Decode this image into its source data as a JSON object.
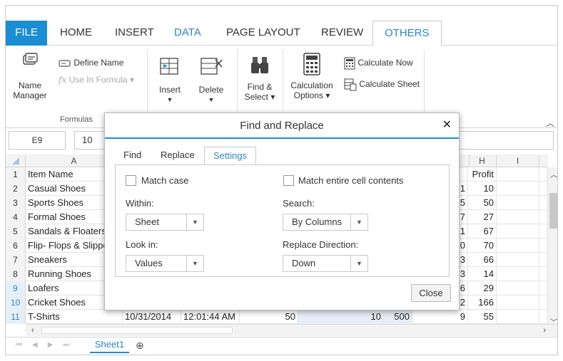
{
  "ribbon_tabs": [
    "FILE",
    "HOME",
    "INSERT",
    "DATA",
    "PAGE LAYOUT",
    "REVIEW",
    "OTHERS"
  ],
  "ribbon": {
    "name_manager": "Name Manager",
    "define_name": "Define Name",
    "use_in_formula": "Use In Formula",
    "formulas_group": "Formulas",
    "insert": "Insert",
    "delete": "Delete",
    "find_select": "Find & Select",
    "calculation_options": "Calculation Options",
    "calculate_now": "Calculate Now",
    "calculate_sheet": "Calculate Sheet"
  },
  "formula_bar": {
    "name_box": "E9",
    "formula": "10"
  },
  "columns": [
    "A",
    "H",
    "I"
  ],
  "rows": [
    {
      "n": "1",
      "a": "Item Name",
      "g": "",
      "h": "Profit"
    },
    {
      "n": "2",
      "a": "Casual Shoes",
      "g": "1",
      "h": "10"
    },
    {
      "n": "3",
      "a": "Sports Shoes",
      "g": "5",
      "h": "50"
    },
    {
      "n": "4",
      "a": "Formal Shoes",
      "g": "7",
      "h": "27"
    },
    {
      "n": "5",
      "a": "Sandals & Floaters",
      "g": "1",
      "h": "67"
    },
    {
      "n": "6",
      "a": "Flip- Flops & Slippers",
      "g": "0",
      "h": "70"
    },
    {
      "n": "7",
      "a": "Sneakers",
      "g": "3",
      "h": "66"
    },
    {
      "n": "8",
      "a": "Running Shoes",
      "g": "3",
      "h": "14"
    },
    {
      "n": "9",
      "a": "Loafers",
      "g": "6",
      "h": "29"
    },
    {
      "n": "10",
      "a": "Cricket Shoes",
      "g": "2",
      "h": "166"
    },
    {
      "n": "11",
      "a": "T-Shirts",
      "g": "9",
      "h": "55"
    }
  ],
  "row11_extra": {
    "b": "10/31/2014",
    "c": "12:01:44 AM",
    "d": "50",
    "e": "10",
    "f": "500"
  },
  "sheet_tab": "Sheet1",
  "dialog": {
    "title": "Find and Replace",
    "tabs": [
      "Find",
      "Replace",
      "Settings"
    ],
    "match_case": "Match case",
    "match_entire": "Match entire cell contents",
    "within_label": "Within:",
    "within_value": "Sheet",
    "search_label": "Search:",
    "search_value": "By Columns",
    "lookin_label": "Look in:",
    "lookin_value": "Values",
    "direction_label": "Replace Direction:",
    "direction_value": "Down",
    "close_label": "Close"
  }
}
